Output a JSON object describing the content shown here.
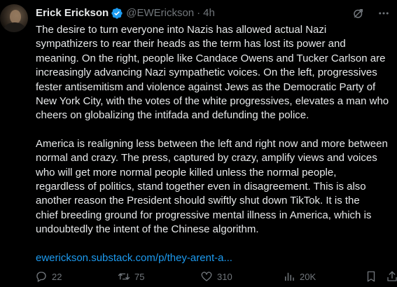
{
  "author": {
    "name": "Erick Erickson",
    "handle": "@EWErickson",
    "separator": "·",
    "time": "4h",
    "verified": true
  },
  "tweet": {
    "paragraph1": "The desire to turn everyone into Nazis has allowed actual Nazi\nsympathizers to rear their heads as the term has lost its power and\nmeaning. On the right, people like Candace Owens and Tucker Carlson are\nincreasingly advancing Nazi sympathetic voices. On the left, progressives\nfester antisemitism and violence against Jews as the Democratic Party of\nNew York City, with the votes of the white progressives, elevates a man who\ncheers on globalizing the intifada and defunding the police.",
    "paragraph2": "America is realigning less between the left and right now and more between\nnormal and crazy. The press, captured by crazy, amplify views and voices\nwho will get more normal people killed unless the normal people,\nregardless of politics, stand together even in disagreement. This is also\nanother reason the President should swiftly shut down TikTok. It is the\nchief breeding ground for progressive mental illness in America, which is\nundoubtedly the intent of the Chinese algorithm.",
    "link": "ewerickson.substack.com/p/they-arent-a..."
  },
  "actions": {
    "replies": "22",
    "retweets": "75",
    "likes": "310",
    "views": "20K"
  },
  "colors": {
    "background": "#000000",
    "text": "#e7e9ea",
    "muted": "#71767b",
    "accent": "#1d9bf0"
  },
  "icons": {
    "verified": "verified-badge-icon",
    "grok": "grok-icon",
    "more": "more-icon",
    "reply": "reply-icon",
    "retweet": "retweet-icon",
    "like": "heart-icon",
    "views": "views-icon",
    "bookmark": "bookmark-icon",
    "share": "share-icon"
  }
}
